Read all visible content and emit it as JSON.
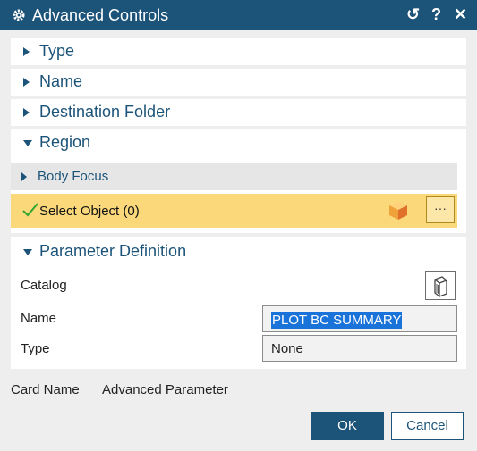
{
  "window": {
    "title": "Advanced Controls",
    "settings_icon": "gear-icon",
    "reset_glyph": "↺",
    "help_glyph": "?",
    "close_glyph": "✕"
  },
  "sections": {
    "type": {
      "label": "Type",
      "expanded": false
    },
    "name": {
      "label": "Name",
      "expanded": false
    },
    "destination": {
      "label": "Destination Folder",
      "expanded": false
    },
    "region": {
      "label": "Region",
      "expanded": true,
      "body_focus": {
        "label": "Body Focus",
        "expanded": false
      },
      "select_object": {
        "label": "Select Object (0)",
        "more_glyph": "···"
      }
    },
    "parameter_definition": {
      "label": "Parameter Definition",
      "expanded": true,
      "catalog_label": "Catalog",
      "name_label": "Name",
      "name_value": "PLOT BC SUMMARY",
      "type_label": "Type",
      "type_value": "None"
    }
  },
  "card": {
    "label": "Card Name",
    "value": "Advanced Parameter"
  },
  "buttons": {
    "ok": "OK",
    "cancel": "Cancel"
  },
  "colors": {
    "titlebar": "#1c5379",
    "highlight": "#fbd97b",
    "selection": "#1a73d9"
  }
}
